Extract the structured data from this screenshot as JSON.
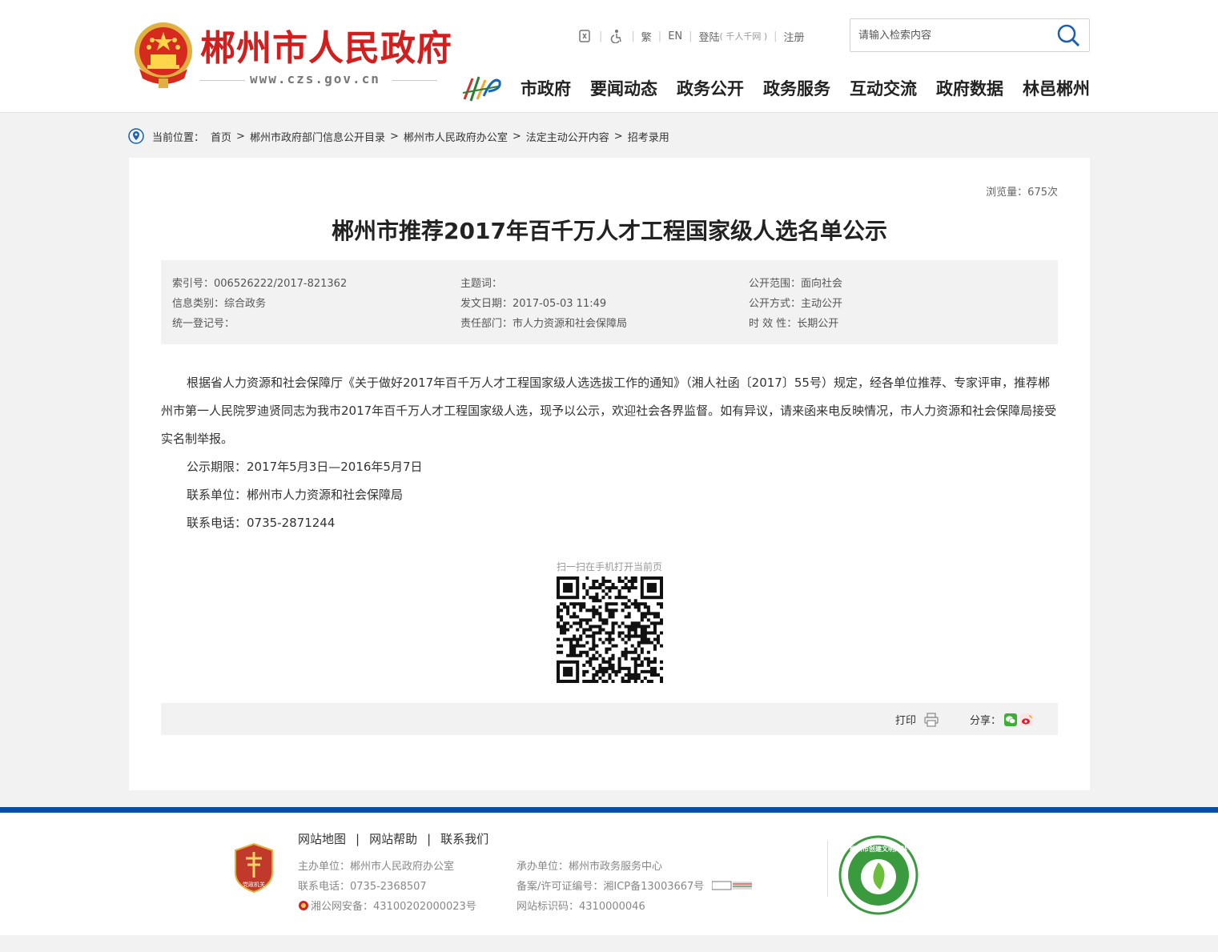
{
  "header": {
    "site_title": "郴州市人民政府",
    "site_url": "www.czs.gov.cn",
    "toolbar": {
      "traditional": "繁",
      "english": "EN",
      "login": "登陆",
      "login_note": "( 千人千网 )",
      "register": "注册",
      "icons": [
        "barrier-free-icon",
        "accessibility-icon"
      ]
    },
    "search": {
      "placeholder": "请输入检索内容"
    },
    "nav": [
      "市政府",
      "要闻动态",
      "政务公开",
      "政务服务",
      "互动交流",
      "政府数据",
      "林邑郴州"
    ]
  },
  "breadcrumb": {
    "label": "当前位置：",
    "items": [
      "首页",
      "郴州市政府部门信息公开目录",
      "郴州市人民政府办公室",
      "法定主动公开内容",
      "招考录用"
    ]
  },
  "article": {
    "views": "浏览量：675次",
    "title": "郴州市推荐2017年百千万人才工程国家级人选名单公示",
    "meta": {
      "index_no": "索引号：006526222/2017-821362",
      "category": "信息类别：综合政务",
      "reg_no": "统一登记号：",
      "keywords": "主题词：",
      "date": "发文日期：2017-05-03 11:49",
      "dept": "责任部门：市人力资源和社会保障局",
      "scope": "公开范围：面向社会",
      "method": "公开方式：主动公开",
      "validity": "时 效 性：长期公开"
    },
    "paragraphs": [
      "根据省人力资源和社会保障厅《关于做好2017年百千万人才工程国家级人选选拔工作的通知》（湘人社函〔2017〕55号）规定，经各单位推荐、专家评审，推荐郴州市第一人民院罗迪贤同志为我市2017年百千万人才工程国家级人选，现予以公示，欢迎社会各界监督。如有异议，请来函来电反映情况，市人力资源和社会保障局接受实名制举报。",
      "公示期限：2017年5月3日—2016年5月7日",
      "联系单位：郴州市人力资源和社会保障局",
      "联系电话：0735-2871244"
    ],
    "qr_caption": "扫一扫在手机打开当前页",
    "print": "打印",
    "share": "分享："
  },
  "footer": {
    "links": [
      "网站地图",
      "网站帮助",
      "联系我们"
    ],
    "left_info": [
      "主办单位：郴州市人民政府办公室",
      "联系电话：0735-2368507",
      "湘公网安备：43100202000023号"
    ],
    "right_info": [
      "承办单位：郴州市政务服务中心",
      "备案/许可证编号：湘ICP备13003667号",
      "网站标识码：4310000046"
    ],
    "badge_left_text": "党政机关",
    "badge_right_text": "郴州市创建文明网站"
  },
  "colors": {
    "brand_red": "#d31e1e",
    "footer_blue": "#064ea0"
  }
}
